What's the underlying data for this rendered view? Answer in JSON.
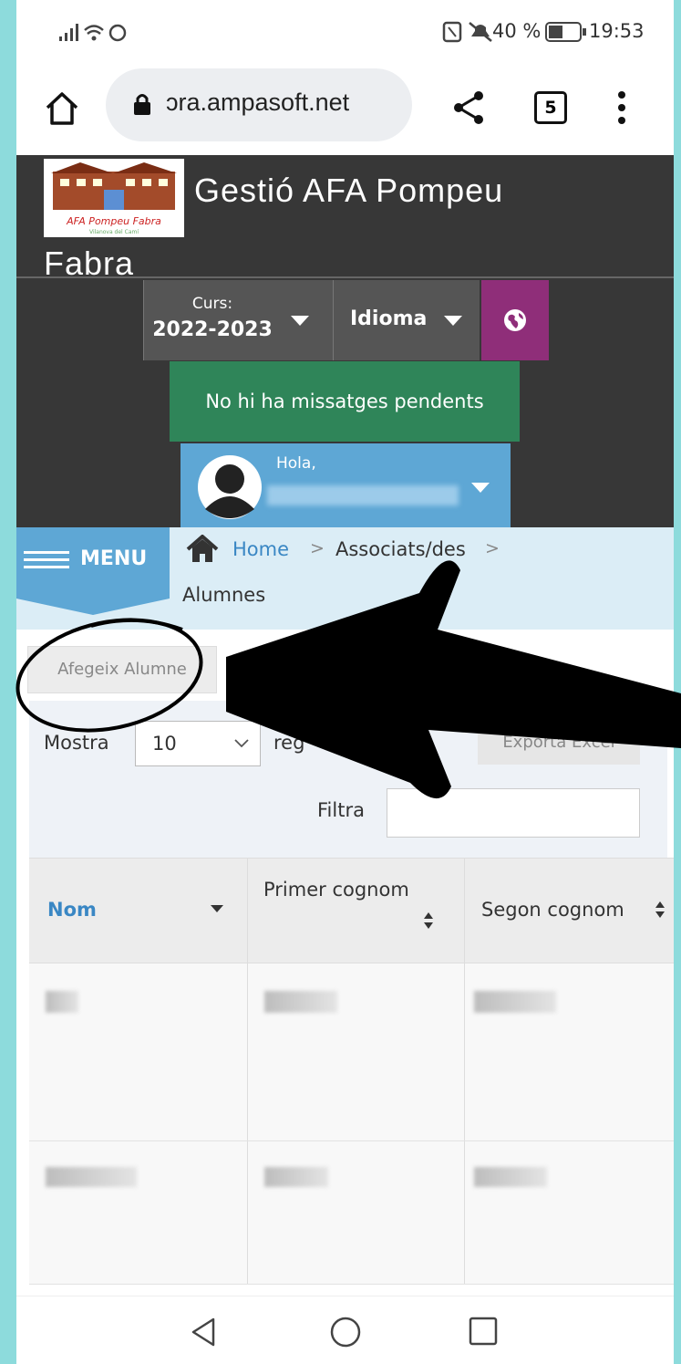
{
  "status_bar": {
    "battery": "40 %",
    "time": "19:53"
  },
  "browser": {
    "url": "ɔra.ampasoft.net",
    "tab_count": "5"
  },
  "app": {
    "title_line1": "Gestió AFA Pompeu",
    "title_line2": "Fabra",
    "logo_text": "AFA Pompeu Fabra"
  },
  "course": {
    "label": "Curs:",
    "value": "2022-2023"
  },
  "language": {
    "label": "Idioma"
  },
  "messages": {
    "text": "No hi ha missatges pendents"
  },
  "user": {
    "greeting": "Hola,"
  },
  "menu": {
    "label": "MENU"
  },
  "breadcrumb": {
    "home": "Home",
    "sep": ">",
    "item1": "Associats/des",
    "item2": "Alumnes"
  },
  "toolbar": {
    "add_label": "Afegeix Alumne",
    "show_label": "Mostra",
    "page_size": "10",
    "records_label": "reg",
    "export_label": "Exporta Excel",
    "filter_label": "Filtra"
  },
  "table": {
    "columns": [
      "Nom",
      "Primer cognom",
      "Segon cognom"
    ]
  },
  "colors": {
    "header_bg": "#373737",
    "messages_bg": "#2f8559",
    "accent_blue": "#5ea7d5",
    "globe_bg": "#8f2e79",
    "frame": "#8ddbdc"
  },
  "icons": [
    "signal-icon",
    "wifi-icon",
    "whatsapp-icon",
    "nfc-icon",
    "mute-icon",
    "battery-icon",
    "home-icon",
    "lock-icon",
    "share-icon",
    "tabs-icon",
    "kebab-menu-icon",
    "caret-down-icon",
    "globe-icon",
    "avatar-icon",
    "hamburger-icon",
    "house-icon",
    "sort-icon",
    "back-icon",
    "circle-home-icon",
    "square-recent-icon"
  ]
}
